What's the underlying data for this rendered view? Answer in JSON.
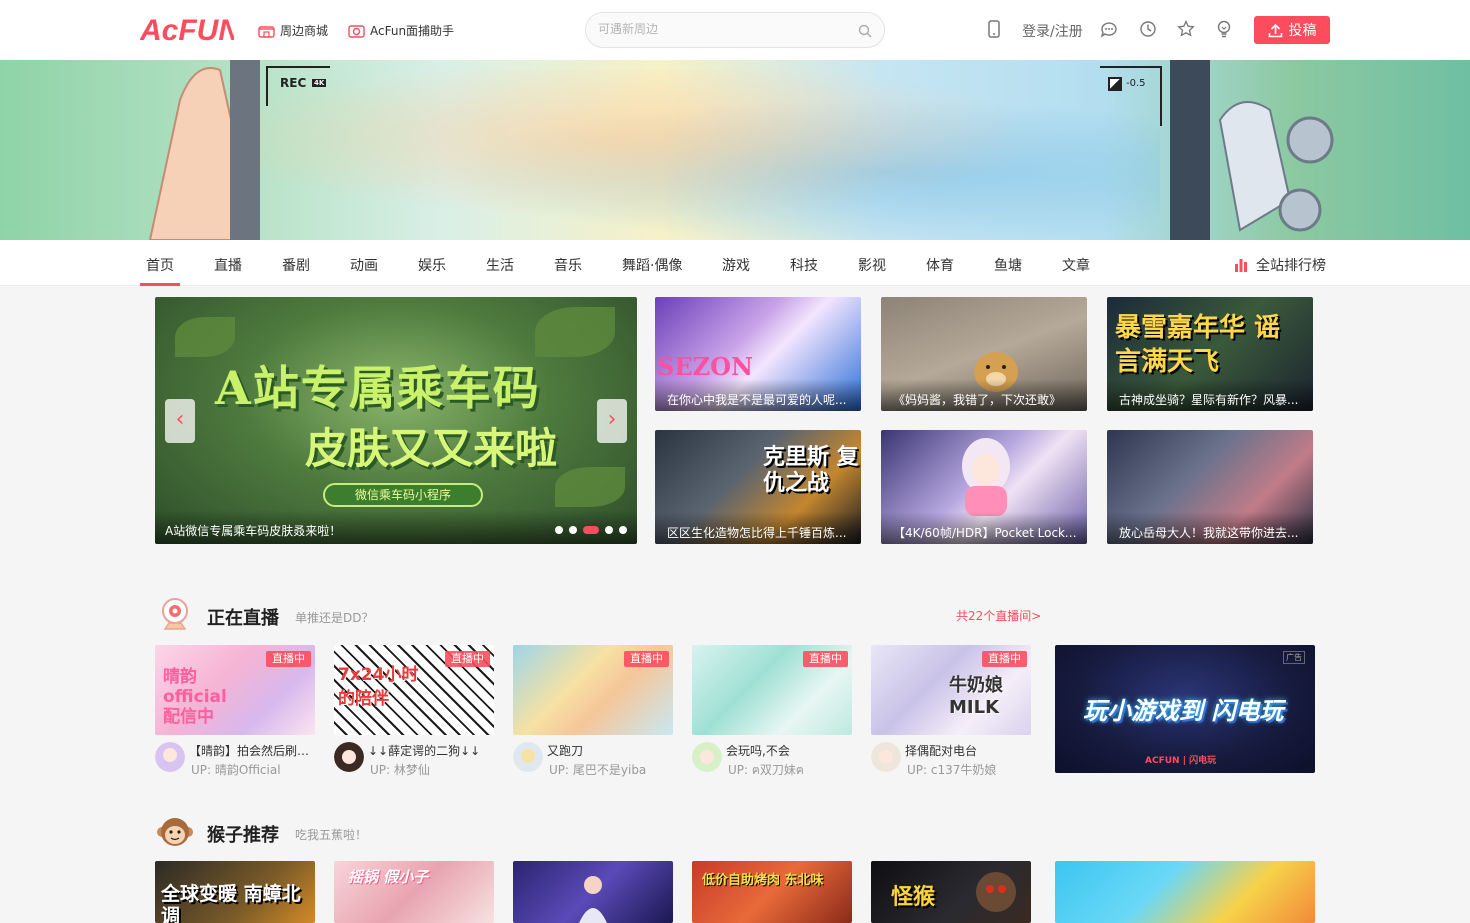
{
  "header": {
    "logo_text": "ACFUN",
    "links": [
      {
        "label": "周边商城",
        "icon": "shop-icon"
      },
      {
        "label": "AcFun面捕助手",
        "icon": "camera-icon"
      }
    ],
    "search_placeholder": "可遇新周边",
    "login_label": "登录/注册",
    "upload_label": "投稿",
    "brand_color": "#fd4c5d"
  },
  "banner": {
    "rec_label": "REC",
    "rec_badge": "4K",
    "ev_label": "-0.5"
  },
  "nav": {
    "items": [
      "首页",
      "直播",
      "番剧",
      "动画",
      "娱乐",
      "生活",
      "音乐",
      "舞蹈·偶像",
      "游戏",
      "科技",
      "影视",
      "体育",
      "鱼塘",
      "文章"
    ],
    "active_index": 0,
    "rank_label": "全站排行榜"
  },
  "carousel": {
    "headline_1": "A站专属乘车码",
    "headline_2": "皮肤又又来啦",
    "pill": "微信乘车码小程序",
    "caption": "A站微信专属乘车码皮肤叒来啦！",
    "prev": "‹",
    "next": "›",
    "slide_count": 5,
    "active_slide": 2
  },
  "thumbs": [
    {
      "caption": "在你心中我是不是最可爱的人呢...",
      "overlay": "SEZON"
    },
    {
      "caption": "《妈妈酱，我错了，下次还敢》",
      "overlay": ""
    },
    {
      "caption": "古神成坐骑？星际有新作？风暴...",
      "overlay": "暴雪嘉年华 谣言满天飞"
    },
    {
      "caption": "区区生化造物怎比得上千锤百炼...",
      "overlay": "克里斯 复仇之战"
    },
    {
      "caption": "【4K/60帧/HDR】Pocket  Locket...",
      "overlay": ""
    },
    {
      "caption": "放心岳母大人！我就这带你进去...",
      "overlay": ""
    }
  ],
  "live": {
    "title": "正在直播",
    "subtitle": "单推还是DD？",
    "more": "共22个直播间>",
    "tag": "直播中",
    "cards": [
      {
        "title": "【晴韵】拍会然后刷异...",
        "up": "UP:  晴韵Official",
        "overlay": "晴韵official 配信中"
      },
      {
        "title": "↓↓薛定谔的二狗↓↓",
        "up": "UP:  林梦仙",
        "overlay": "7x24小时 的陪伴"
      },
      {
        "title": "又跑刀",
        "up": "UP:  尾巴不是yiba",
        "overlay": ""
      },
      {
        "title": "会玩吗,不会",
        "up": "UP:  ฅ双刀妹ฅ",
        "overlay": ""
      },
      {
        "title": "择偶配对电台",
        "up": "UP:  c137牛奶娘",
        "overlay": "牛奶娘 MILK"
      }
    ],
    "ad": {
      "text": "玩小游戏到 闪电玩",
      "logo": "ACFUN | 闪电玩",
      "badge": "广告"
    }
  },
  "monkey": {
    "title": "猴子推荐",
    "subtitle": "吃我五蕉啦！",
    "cards": [
      "全球变暖 南蟑北调",
      "摇锅 假小子",
      "",
      "低价自助烤肉 东北味",
      "怪猴",
      ""
    ]
  }
}
